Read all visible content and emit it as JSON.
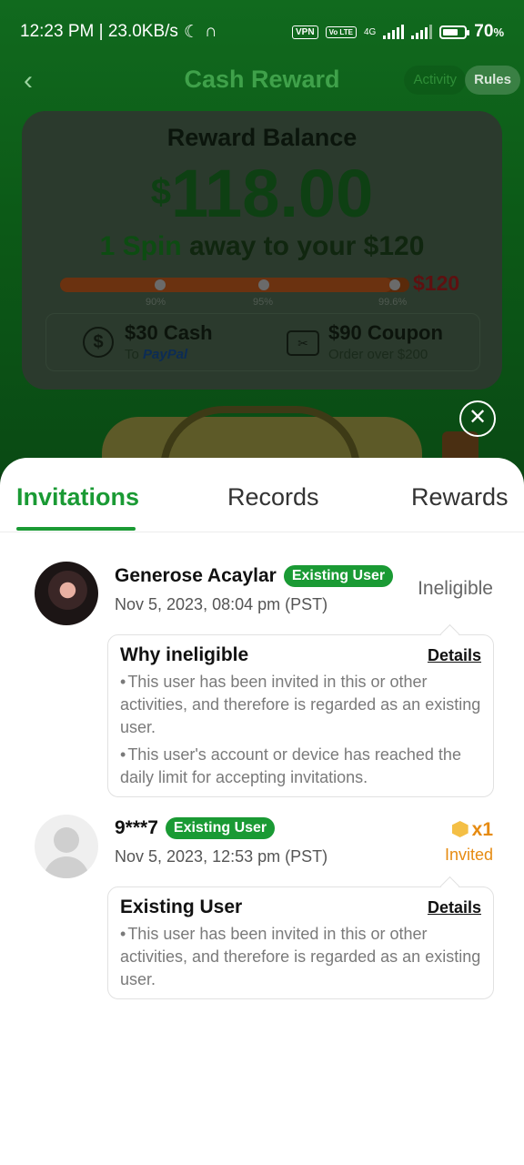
{
  "status_bar": {
    "time_speed": "12:23 PM | 23.0KB/s",
    "vpn": "VPN",
    "volte": "Vo LTE",
    "network": "4G",
    "battery": "70",
    "battery_unit": "%",
    "battery_level": 0.7
  },
  "header": {
    "title": "Cash Reward",
    "activity_label": "Activity",
    "rules_label": "Rules"
  },
  "balance": {
    "title": "Reward Balance",
    "currency": "$",
    "amount": "118.00",
    "spin_highlight": "1 Spin",
    "spin_rest": " away to your $120",
    "target": "$120",
    "progress_fraction": 0.95,
    "milestones": [
      "90%",
      "95%",
      "99.6%"
    ],
    "tiles": [
      {
        "title": "$30 Cash",
        "sub_prefix": "To ",
        "sub_brand": "PayPal",
        "icon": "dollar-circle-icon"
      },
      {
        "title": "$90 Coupon",
        "sub_prefix": "Order over $200",
        "sub_brand": "",
        "icon": "coupon-icon"
      }
    ]
  },
  "sheet": {
    "tabs": [
      "Invitations",
      "Records",
      "Rewards"
    ],
    "active_tab": 0,
    "invitations": [
      {
        "name": "Generose Acaylar",
        "badge": "Existing User",
        "date": "Nov 5, 2023, 08:04 pm (PST)",
        "status": "Ineligible",
        "info_title": "Why ineligible",
        "details_label": "Details",
        "reasons": [
          "This user has been invited in this or other activities, and therefore is regarded as an existing user.",
          "This user's account or device has reached the daily limit for accepting invitations."
        ]
      },
      {
        "name": "9***7",
        "badge": "Existing User",
        "date": "Nov 5, 2023, 12:53 pm (PST)",
        "reward_count": "x1",
        "status": "Invited",
        "info_title": "Existing User",
        "details_label": "Details",
        "reasons": [
          "This user has been invited in this or other activities, and therefore is regarded as an existing user."
        ]
      }
    ]
  },
  "colors": {
    "accent": "#1a9a34",
    "reward_orange": "#e68b12"
  }
}
